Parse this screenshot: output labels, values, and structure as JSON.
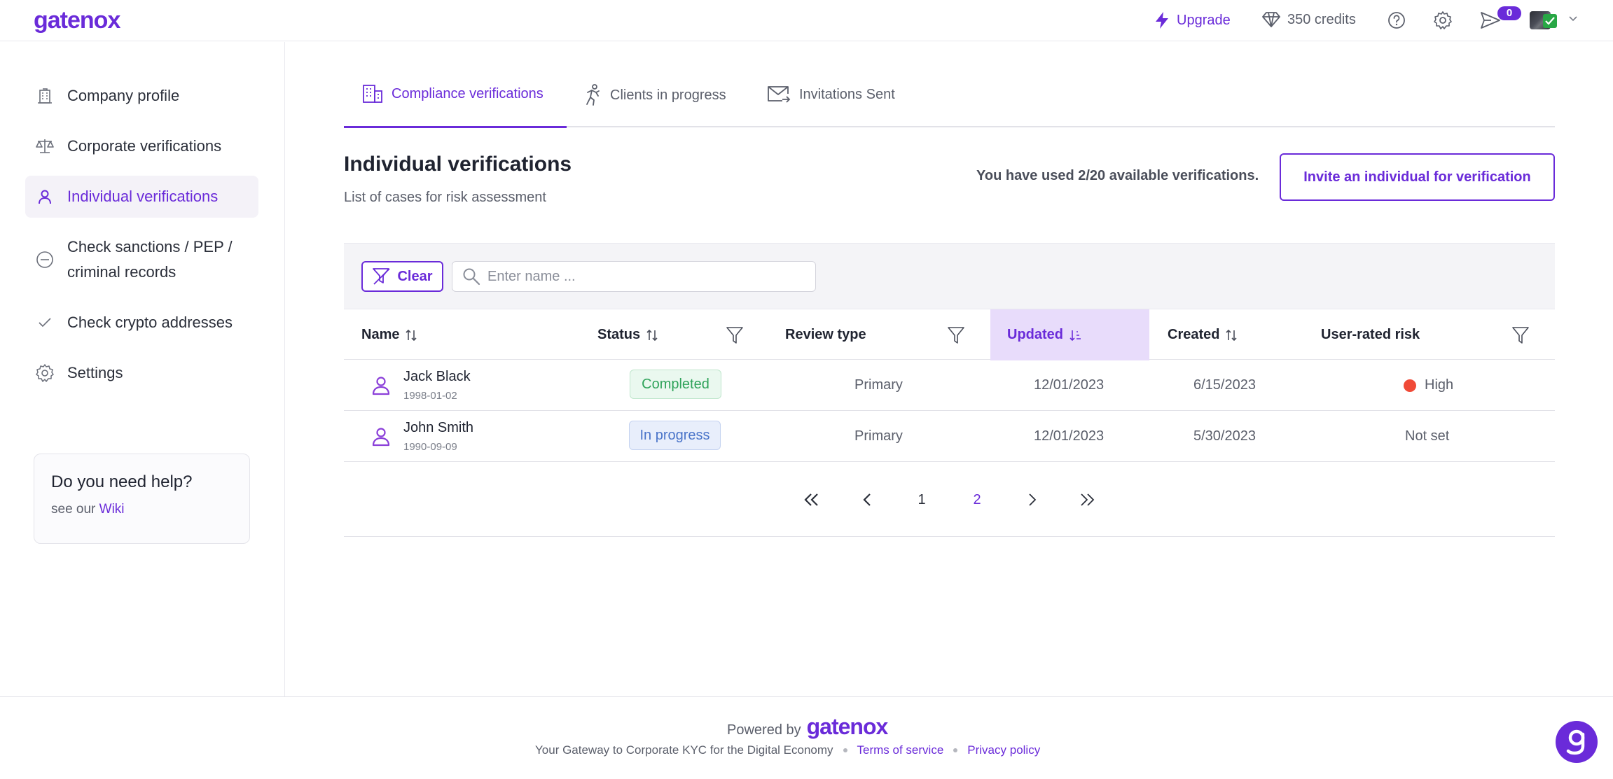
{
  "header": {
    "logo": "gatenox",
    "upgrade_label": "Upgrade",
    "credits_label": "350 credits",
    "notifications_count": "0"
  },
  "sidebar": {
    "items": [
      {
        "label": "Company profile",
        "icon": "building-icon"
      },
      {
        "label": "Corporate verifications",
        "icon": "scales-icon"
      },
      {
        "label": "Individual verifications",
        "icon": "person-icon",
        "active": true
      },
      {
        "label": "Check sanctions / PEP / criminal records",
        "icon": "minus-circle-icon"
      },
      {
        "label": "Check crypto addresses",
        "icon": "check-icon"
      },
      {
        "label": "Settings",
        "icon": "gear-icon"
      }
    ],
    "help": {
      "title": "Do you need help?",
      "text": "see our",
      "link": "Wiki"
    }
  },
  "tabs": [
    {
      "label": "Compliance verifications",
      "icon": "building-grid-icon",
      "active": true
    },
    {
      "label": "Clients in progress",
      "icon": "running-person-icon"
    },
    {
      "label": "Invitations Sent",
      "icon": "mail-send-icon"
    }
  ],
  "main": {
    "title": "Individual verifications",
    "subtitle": "List of cases for risk assessment",
    "usage": "You have used 2/20 available verifications.",
    "invite_button": "Invite an individual for verification"
  },
  "filters": {
    "clear_label": "Clear",
    "search_placeholder": "Enter name ..."
  },
  "table": {
    "columns": {
      "name": "Name",
      "status": "Status",
      "review_type": "Review type",
      "updated": "Updated",
      "created": "Created",
      "risk": "User-rated risk"
    },
    "rows": [
      {
        "name": "Jack Black",
        "dob": "1998-01-02",
        "status": "Completed",
        "review_type": "Primary",
        "updated": "12/01/2023",
        "created": "6/15/2023",
        "risk": "High"
      },
      {
        "name": "John Smith",
        "dob": "1990-09-09",
        "status": "In progress",
        "review_type": "Primary",
        "updated": "12/01/2023",
        "created": "5/30/2023",
        "risk": "Not set"
      }
    ]
  },
  "pagination": {
    "pages": [
      "1",
      "2"
    ],
    "current": "2"
  },
  "footer": {
    "powered_by": "Powered by",
    "brand": "gatenox",
    "tagline": "Your Gateway to Corporate KYC for the Digital Economy",
    "terms": "Terms of service",
    "privacy": "Privacy policy"
  },
  "colors": {
    "accent": "#6a2bd9",
    "completed": "#2fa35a",
    "in_progress": "#4a74c9",
    "risk_high": "#f04a37"
  }
}
